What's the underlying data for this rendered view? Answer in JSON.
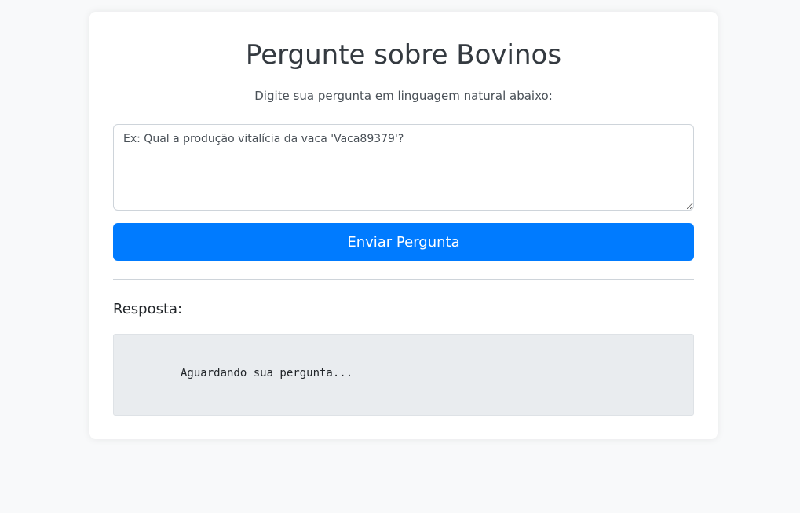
{
  "page": {
    "title": "Pergunte sobre Bovinos",
    "subtitle": "Digite sua pergunta em linguagem natural abaixo:"
  },
  "question": {
    "placeholder": "Ex: Qual a produção vitalícia da vaca 'Vaca89379'?",
    "value": ""
  },
  "submit": {
    "label": "Enviar Pergunta"
  },
  "answer": {
    "label": "Resposta:",
    "text": "Aguardando sua pergunta..."
  },
  "colors": {
    "primary": "#007bff",
    "background": "#f8f9fa",
    "answer_bg": "#e9ecef"
  }
}
